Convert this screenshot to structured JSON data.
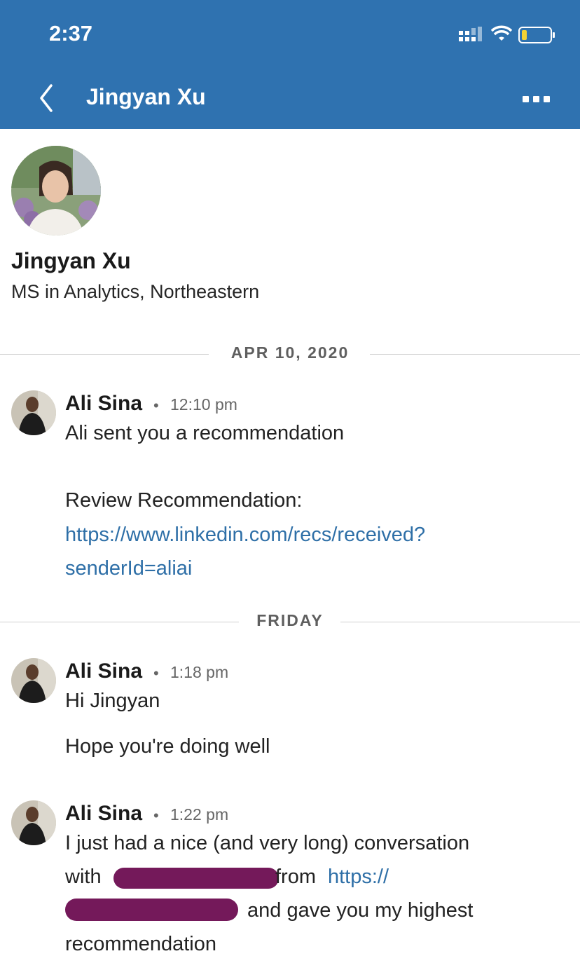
{
  "status_bar": {
    "time": "2:37"
  },
  "nav": {
    "title": "Jingyan Xu"
  },
  "profile": {
    "name": "Jingyan Xu",
    "headline": "MS in Analytics, Northeastern"
  },
  "conversation": {
    "dividers": [
      "APR 10, 2020",
      "FRIDAY"
    ],
    "messages": [
      {
        "sender": "Ali Sina",
        "time": "12:10 pm",
        "lines": [
          "Ali sent you a recommendation",
          "Review Recommendation:"
        ],
        "link_lines": [
          "https://www.linkedin.com/recs/received?",
          "senderId=aliai"
        ]
      },
      {
        "sender": "Ali Sina",
        "time": "1:18 pm",
        "lines": [
          "Hi Jingyan",
          "Hope you're doing well"
        ]
      },
      {
        "sender": "Ali Sina",
        "time": "1:22 pm",
        "line1": "I just had a nice (and very long) conversation",
        "line2_a": "with",
        "line2_b": "from",
        "line2_link": "https://",
        "line3": "and gave you my highest",
        "line4": "recommendation"
      }
    ]
  },
  "colors": {
    "header_bg": "#2f72b0",
    "link": "#2e6fa7",
    "redaction": "#74195a"
  }
}
